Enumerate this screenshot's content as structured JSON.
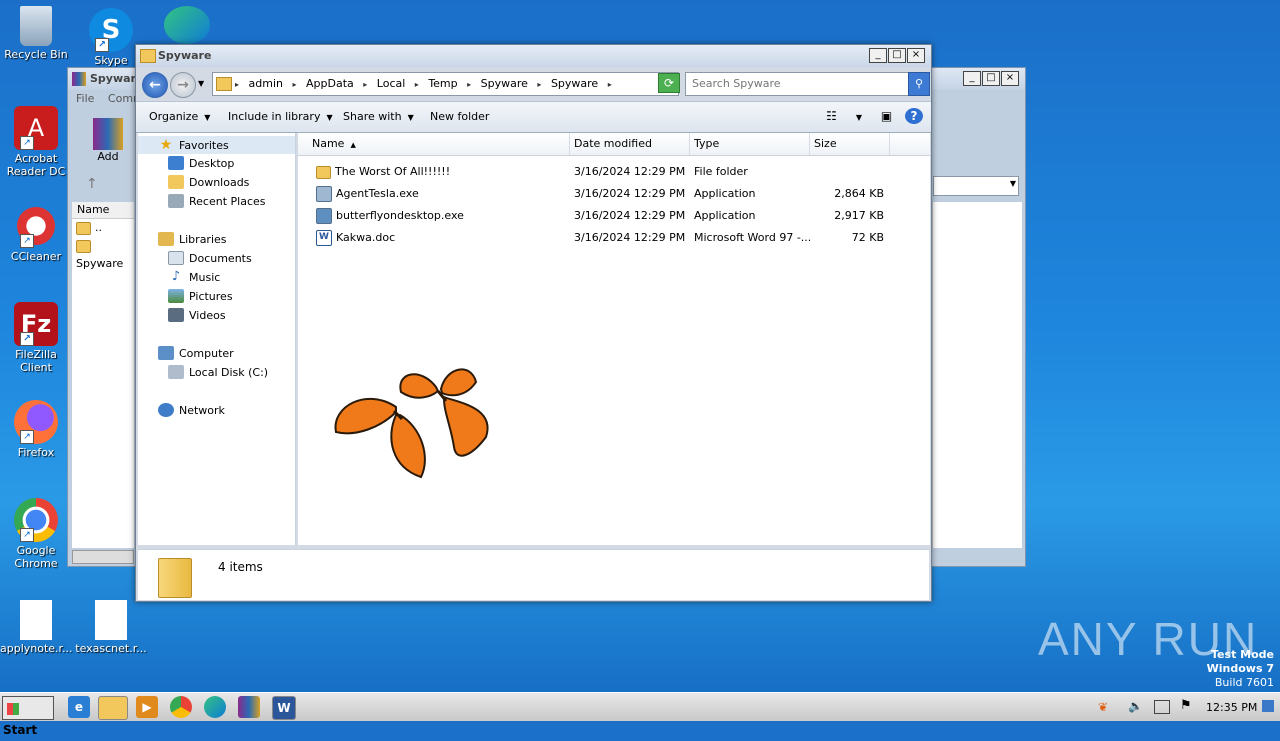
{
  "desktop": {
    "icons": [
      {
        "label": "Recycle Bin"
      },
      {
        "label": "Skype"
      },
      {
        "label": "Acrobat Reader DC"
      },
      {
        "label": "CCleaner"
      },
      {
        "label": "FileZilla Client"
      },
      {
        "label": "Firefox"
      },
      {
        "label": "Google Chrome"
      },
      {
        "label": "applynote.r..."
      },
      {
        "label": "texascnet.r..."
      }
    ]
  },
  "bg_window": {
    "title": "Spyware",
    "menu_file": "File",
    "menu_comm": "Comm",
    "add_label": "Add",
    "col_name": "Name",
    "rows": [
      "..",
      "Spyware"
    ]
  },
  "window": {
    "title": "Spyware",
    "breadcrumb": [
      "admin",
      "AppData",
      "Local",
      "Temp",
      "Spyware",
      "Spyware"
    ],
    "search_placeholder": "Search Spyware",
    "toolbar": {
      "organize": "Organize",
      "include": "Include in library",
      "share": "Share with",
      "new_folder": "New folder"
    },
    "nav": {
      "favorites": "Favorites",
      "desktop": "Desktop",
      "downloads": "Downloads",
      "recent": "Recent Places",
      "libraries": "Libraries",
      "documents": "Documents",
      "music": "Music",
      "pictures": "Pictures",
      "videos": "Videos",
      "computer": "Computer",
      "local_disk": "Local Disk (C:)",
      "network": "Network"
    },
    "columns": {
      "name": "Name",
      "date": "Date modified",
      "type": "Type",
      "size": "Size"
    },
    "files": [
      {
        "name": "The Worst Of All!!!!!!",
        "date": "3/16/2024 12:29 PM",
        "type": "File folder",
        "size": ""
      },
      {
        "name": "AgentTesla.exe",
        "date": "3/16/2024 12:29 PM",
        "type": "Application",
        "size": "2,864 KB"
      },
      {
        "name": "butterflyondesktop.exe",
        "date": "3/16/2024 12:29 PM",
        "type": "Application",
        "size": "2,917 KB"
      },
      {
        "name": "Kakwa.doc",
        "date": "3/16/2024 12:29 PM",
        "type": "Microsoft Word 97 -...",
        "size": "72 KB"
      }
    ],
    "status": "4 items"
  },
  "taskbar": {
    "start": "Start",
    "clock": "12:35 PM"
  },
  "watermark": "ANY RUN",
  "sysinfo": {
    "line1": "Test Mode",
    "line2": "Windows 7",
    "line3": "Build 7601"
  },
  "colors": {
    "accent": "#2f6fd1",
    "folder": "#f2c75b"
  }
}
